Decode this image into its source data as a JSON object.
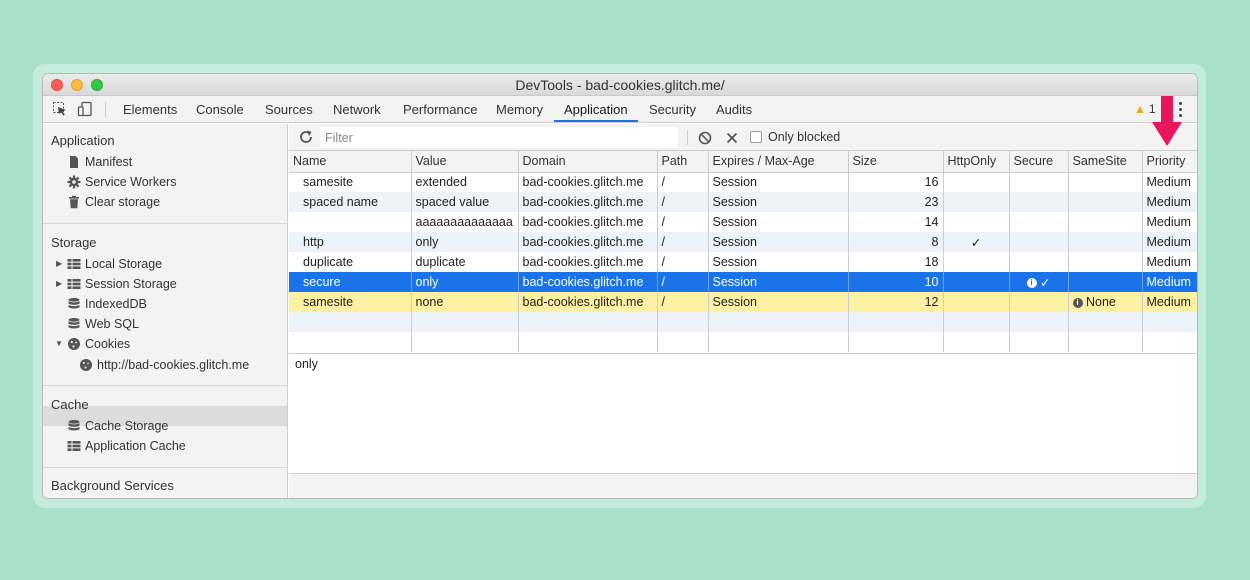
{
  "window": {
    "title": "DevTools - bad-cookies.glitch.me/"
  },
  "tabs": [
    {
      "label": "Elements"
    },
    {
      "label": "Console"
    },
    {
      "label": "Sources"
    },
    {
      "label": "Network"
    },
    {
      "label": "Performance"
    },
    {
      "label": "Memory"
    },
    {
      "label": "Application",
      "active": true
    },
    {
      "label": "Security"
    },
    {
      "label": "Audits"
    }
  ],
  "warnings": {
    "count": "1"
  },
  "sidebar": {
    "application_heading": "Application",
    "application_items": [
      {
        "label": "Manifest",
        "icon": "file-icon"
      },
      {
        "label": "Service Workers",
        "icon": "gear-icon"
      },
      {
        "label": "Clear storage",
        "icon": "trash-icon"
      }
    ],
    "storage_heading": "Storage",
    "storage_items": [
      {
        "label": "Local Storage",
        "icon": "grid-icon"
      },
      {
        "label": "Session Storage",
        "icon": "grid-icon"
      },
      {
        "label": "IndexedDB",
        "icon": "database-icon"
      },
      {
        "label": "Web SQL",
        "icon": "database-icon"
      },
      {
        "label": "Cookies",
        "icon": "cookie-icon"
      },
      {
        "label": "http://bad-cookies.glitch.me",
        "icon": "cookie-icon"
      }
    ],
    "cache_heading": "Cache",
    "cache_items": [
      {
        "label": "Cache Storage",
        "icon": "database-icon"
      },
      {
        "label": "Application Cache",
        "icon": "grid-icon"
      }
    ],
    "background_heading": "Background Services"
  },
  "filter": {
    "placeholder": "Filter",
    "only_blocked_label": "Only blocked"
  },
  "table": {
    "columns": [
      "Name",
      "Value",
      "Domain",
      "Path",
      "Expires / Max-Age",
      "Size",
      "HttpOnly",
      "Secure",
      "SameSite",
      "Priority"
    ],
    "rows": [
      {
        "name": "samesite",
        "value": "extended",
        "domain": "bad-cookies.glitch.me",
        "path": "/",
        "expires": "Session",
        "size": "16",
        "httponly": "",
        "secure": "",
        "samesite": "",
        "priority": "Medium"
      },
      {
        "name": "spaced name",
        "value": "spaced value",
        "domain": "bad-cookies.glitch.me",
        "path": "/",
        "expires": "Session",
        "size": "23",
        "httponly": "",
        "secure": "",
        "samesite": "",
        "priority": "Medium"
      },
      {
        "name": "",
        "value": "aaaaaaaaaaaaaa",
        "domain": "bad-cookies.glitch.me",
        "path": "/",
        "expires": "Session",
        "size": "14",
        "httponly": "",
        "secure": "",
        "samesite": "",
        "priority": "Medium"
      },
      {
        "name": "http",
        "value": "only",
        "domain": "bad-cookies.glitch.me",
        "path": "/",
        "expires": "Session",
        "size": "8",
        "httponly": "✓",
        "secure": "",
        "samesite": "",
        "priority": "Medium"
      },
      {
        "name": "duplicate",
        "value": "duplicate",
        "domain": "bad-cookies.glitch.me",
        "path": "/",
        "expires": "Session",
        "size": "18",
        "httponly": "",
        "secure": "",
        "samesite": "",
        "priority": "Medium"
      },
      {
        "name": "secure",
        "value": "only",
        "domain": "bad-cookies.glitch.me",
        "path": "/",
        "expires": "Session",
        "size": "10",
        "httponly": "",
        "secure": "✓",
        "samesite": "",
        "priority": "Medium"
      },
      {
        "name": "samesite",
        "value": "none",
        "domain": "bad-cookies.glitch.me",
        "path": "/",
        "expires": "Session",
        "size": "12",
        "httponly": "",
        "secure": "",
        "samesite": "None",
        "priority": "Medium"
      }
    ]
  },
  "preview": {
    "value": "only"
  },
  "colors": {
    "accent": "#1a73e8",
    "warning_row": "#fdf1a4",
    "arrow": "#e8175d",
    "background": "#a8e0cb"
  }
}
